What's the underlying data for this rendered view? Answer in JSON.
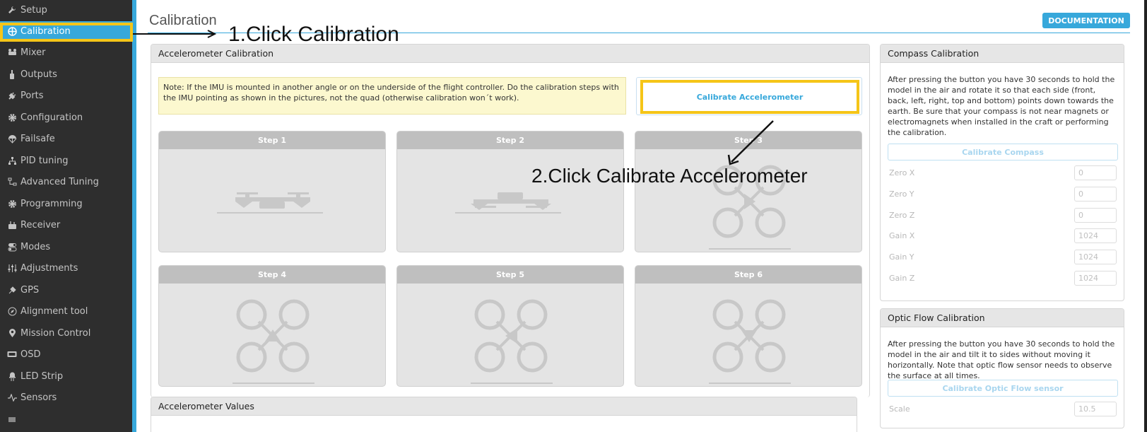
{
  "sidebar": {
    "items": [
      {
        "label": "Setup",
        "icon": "wrench-icon"
      },
      {
        "label": "Calibration",
        "icon": "crosshair-icon"
      },
      {
        "label": "Mixer",
        "icon": "mixer-icon"
      },
      {
        "label": "Outputs",
        "icon": "outputs-icon"
      },
      {
        "label": "Ports",
        "icon": "plug-icon"
      },
      {
        "label": "Configuration",
        "icon": "gear-icon"
      },
      {
        "label": "Failsafe",
        "icon": "parachute-icon"
      },
      {
        "label": "PID tuning",
        "icon": "sitemap-icon"
      },
      {
        "label": "Advanced Tuning",
        "icon": "tree-icon"
      },
      {
        "label": "Programming",
        "icon": "gear-icon"
      },
      {
        "label": "Receiver",
        "icon": "receiver-icon"
      },
      {
        "label": "Modes",
        "icon": "toggle-icon"
      },
      {
        "label": "Adjustments",
        "icon": "sliders-icon"
      },
      {
        "label": "GPS",
        "icon": "satellite-icon"
      },
      {
        "label": "Alignment tool",
        "icon": "compass-icon"
      },
      {
        "label": "Mission Control",
        "icon": "map-pin-icon"
      },
      {
        "label": "OSD",
        "icon": "osd-icon"
      },
      {
        "label": "LED Strip",
        "icon": "led-icon"
      },
      {
        "label": "Sensors",
        "icon": "pulse-icon"
      }
    ],
    "active_index": 1,
    "accent": "#37a8db"
  },
  "header": {
    "title": "Calibration",
    "doc_button": "DOCUMENTATION"
  },
  "accelerometer": {
    "title": "Accelerometer Calibration",
    "note": "Note: If the IMU is mounted in another angle or on the underside of the flight controller. Do the calibration steps with the IMU pointing as shown in the pictures, not the quad (otherwise calibration won´t work).",
    "calibrate_button": "Calibrate Accelerometer",
    "steps": [
      {
        "label": "Step 1",
        "image": "quad-level-side"
      },
      {
        "label": "Step 2",
        "image": "quad-upside-down-side"
      },
      {
        "label": "Step 3",
        "image": "quad-top-arrow-right"
      },
      {
        "label": "Step 4",
        "image": "quad-top-arrow-up"
      },
      {
        "label": "Step 5",
        "image": "quad-top-arrow-left"
      },
      {
        "label": "Step 6",
        "image": "quad-top-arrow-down"
      }
    ]
  },
  "accel_values": {
    "title": "Accelerometer Values"
  },
  "compass": {
    "title": "Compass Calibration",
    "text": "After pressing the button you have 30 seconds to hold the model in the air and rotate it so that each side (front, back, left, right, top and bottom) points down towards the earth. Be sure that your compass is not near magnets or electromagnets when installed in the craft or performing the calibration.",
    "button": "Calibrate Compass",
    "fields": [
      {
        "label": "Zero X",
        "value": "0"
      },
      {
        "label": "Zero Y",
        "value": "0"
      },
      {
        "label": "Zero Z",
        "value": "0"
      },
      {
        "label": "Gain X",
        "value": "1024"
      },
      {
        "label": "Gain Y",
        "value": "1024"
      },
      {
        "label": "Gain Z",
        "value": "1024"
      }
    ]
  },
  "optic_flow": {
    "title": "Optic Flow Calibration",
    "text": "After pressing the button you have 30 seconds to hold the model in the air and tilt it to sides without moving it horizontally. Note that optic flow sensor needs to observe the surface at all times.",
    "button": "Calibrate Optic Flow sensor",
    "scale_label": "Scale",
    "scale_value": "10.5"
  },
  "annotations": {
    "step1": "1.Click Calibration",
    "step2": "2.Click Calibrate Accelerometer",
    "highlight_color": "#f5c518"
  }
}
